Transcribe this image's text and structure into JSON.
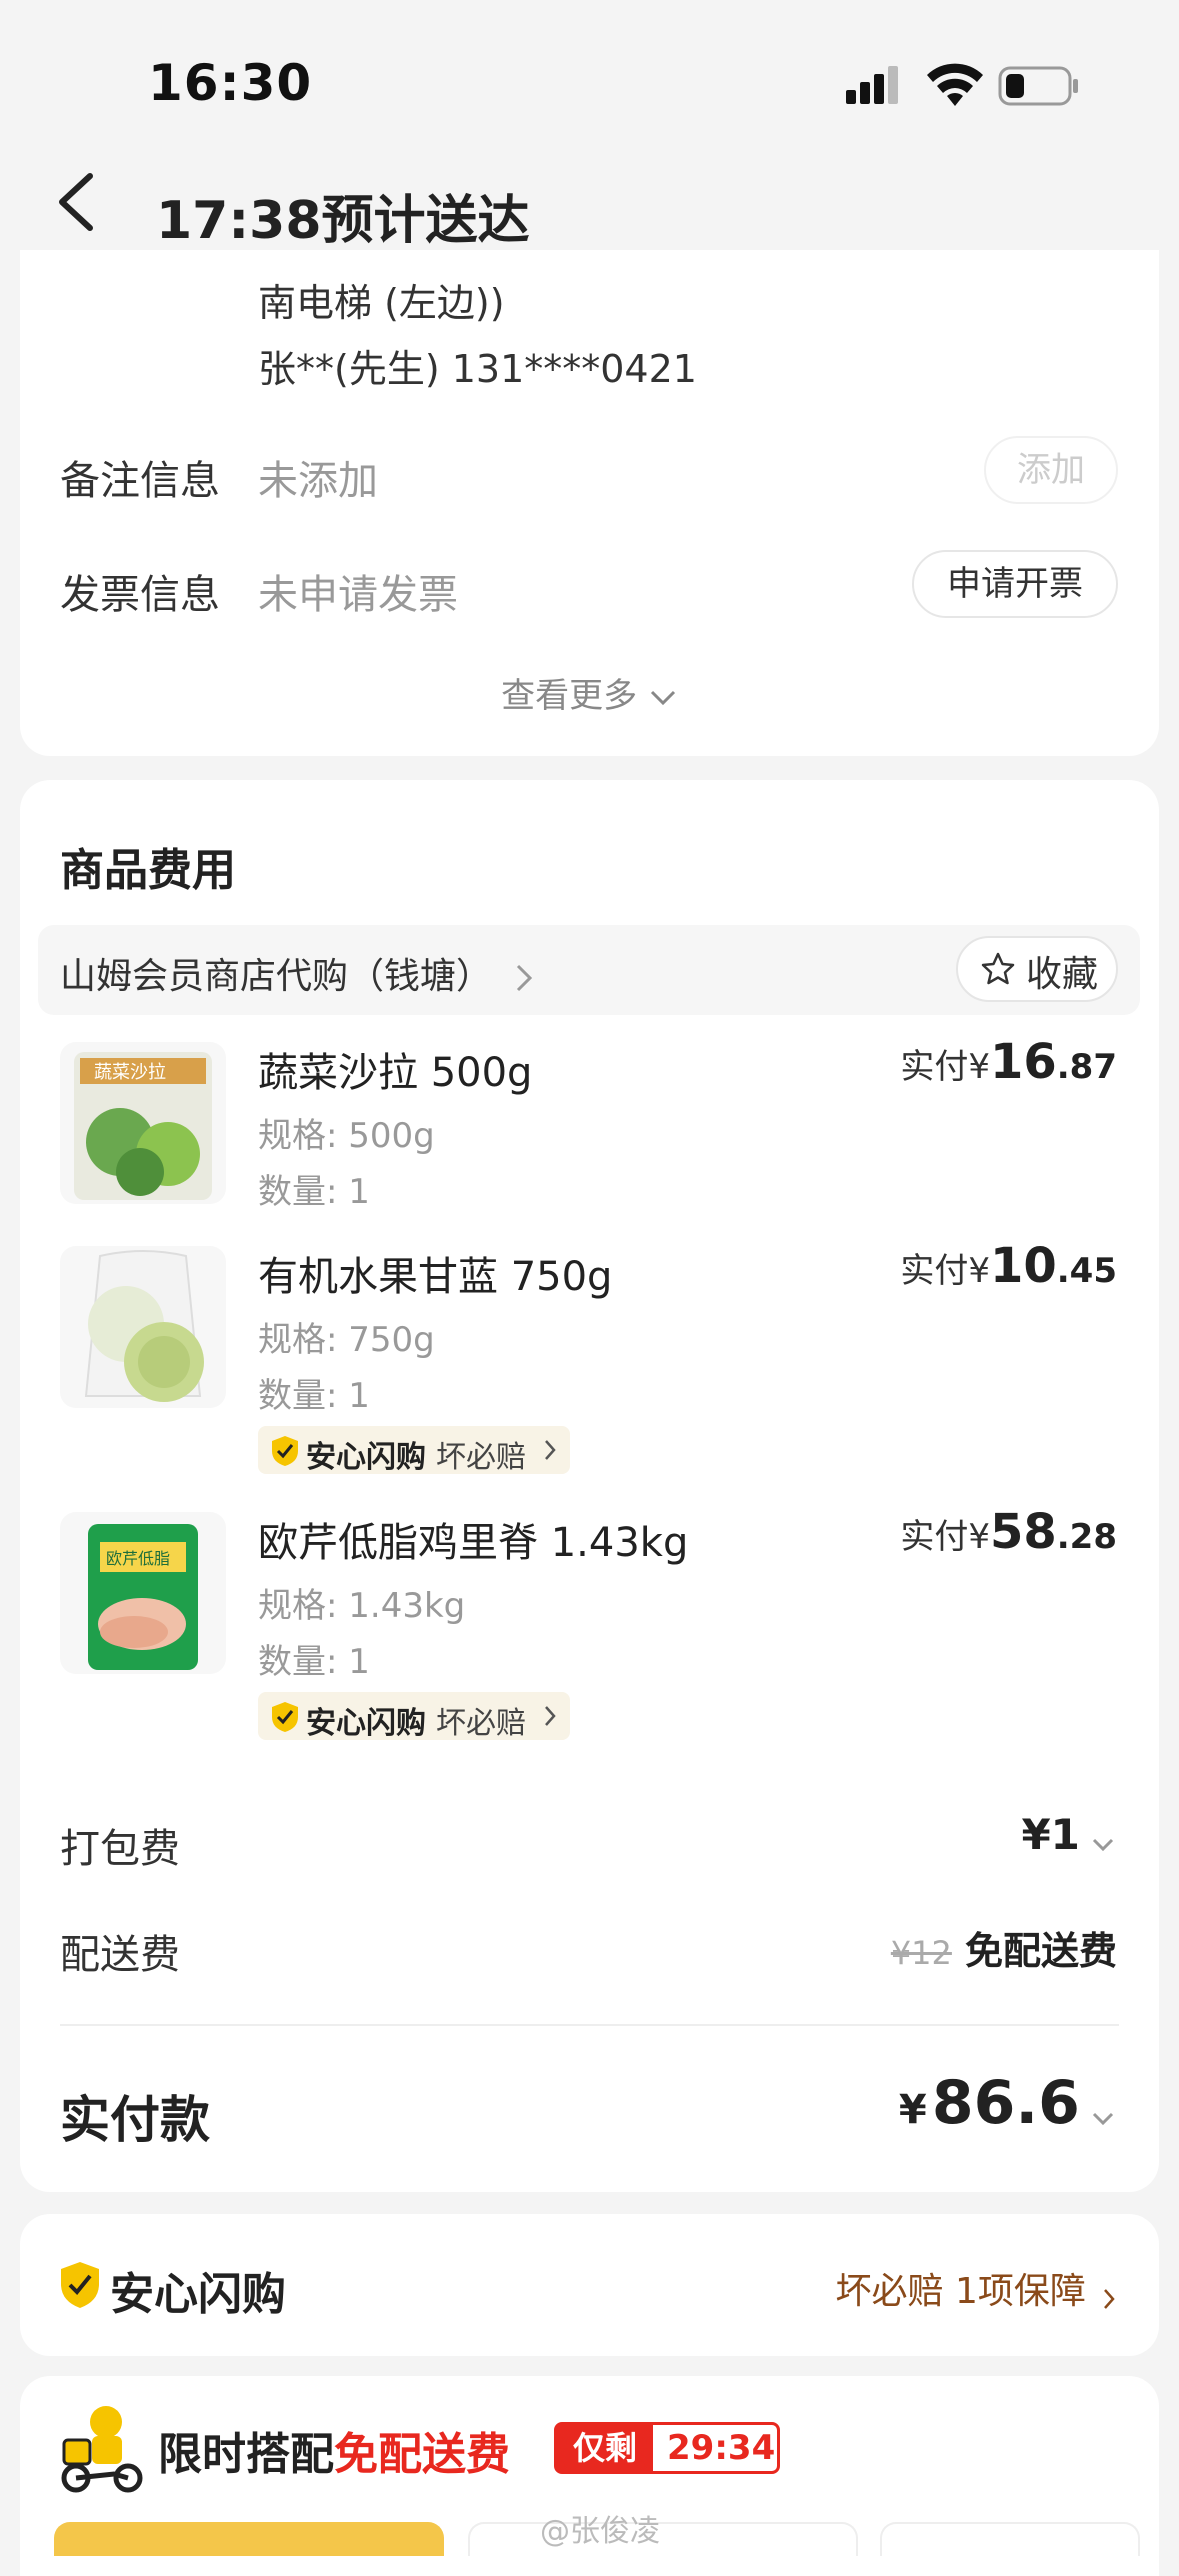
{
  "status": {
    "time": "16:30"
  },
  "nav": {
    "title": "17:38预计送达"
  },
  "address": {
    "line1": "南电梯 (左边))",
    "contact": "张**(先生) 131****0421"
  },
  "remark": {
    "label": "备注信息",
    "value": "未添加",
    "button": "添加"
  },
  "invoice": {
    "label": "发票信息",
    "value": "未申请发票",
    "button": "申请开票"
  },
  "view_more": "查看更多",
  "goods": {
    "title": "商品费用",
    "store": "山姆会员商店代购（钱塘）",
    "favorite": "收藏",
    "items": [
      {
        "name": "蔬菜沙拉 500g",
        "spec": "规格: 500g",
        "qty": "数量: 1",
        "paid_label": "实付",
        "currency": "¥",
        "int": "16",
        "dec": ".87"
      },
      {
        "name": "有机水果甘蓝 750g",
        "spec": "规格: 750g",
        "qty": "数量: 1",
        "paid_label": "实付",
        "currency": "¥",
        "int": "10",
        "dec": ".45",
        "badge": "安心闪购",
        "badge_sub": "坏必赔"
      },
      {
        "name": "欧芹低脂鸡里脊 1.43kg",
        "spec": "规格: 1.43kg",
        "qty": "数量: 1",
        "paid_label": "实付",
        "currency": "¥",
        "int": "58",
        "dec": ".28",
        "badge": "安心闪购",
        "badge_sub": "坏必赔"
      }
    ],
    "packing": {
      "label": "打包费",
      "value": "¥1"
    },
    "delivery": {
      "label": "配送费",
      "original": "¥12",
      "value": "免配送费"
    },
    "total": {
      "label": "实付款",
      "currency": "¥",
      "value": "86.6"
    }
  },
  "guarantee": {
    "title": "安心闪购",
    "text": "坏必赔 1项保障"
  },
  "promo": {
    "title": "限时搭配",
    "highlight": "免配送费",
    "remaining_label": "仅剩",
    "countdown": "29:34",
    "watermark": "@张俊凌"
  },
  "colors": {
    "accent_red": "#e8281f",
    "badge_yellow": "#f6c400",
    "bg": "#f4f4f4"
  }
}
